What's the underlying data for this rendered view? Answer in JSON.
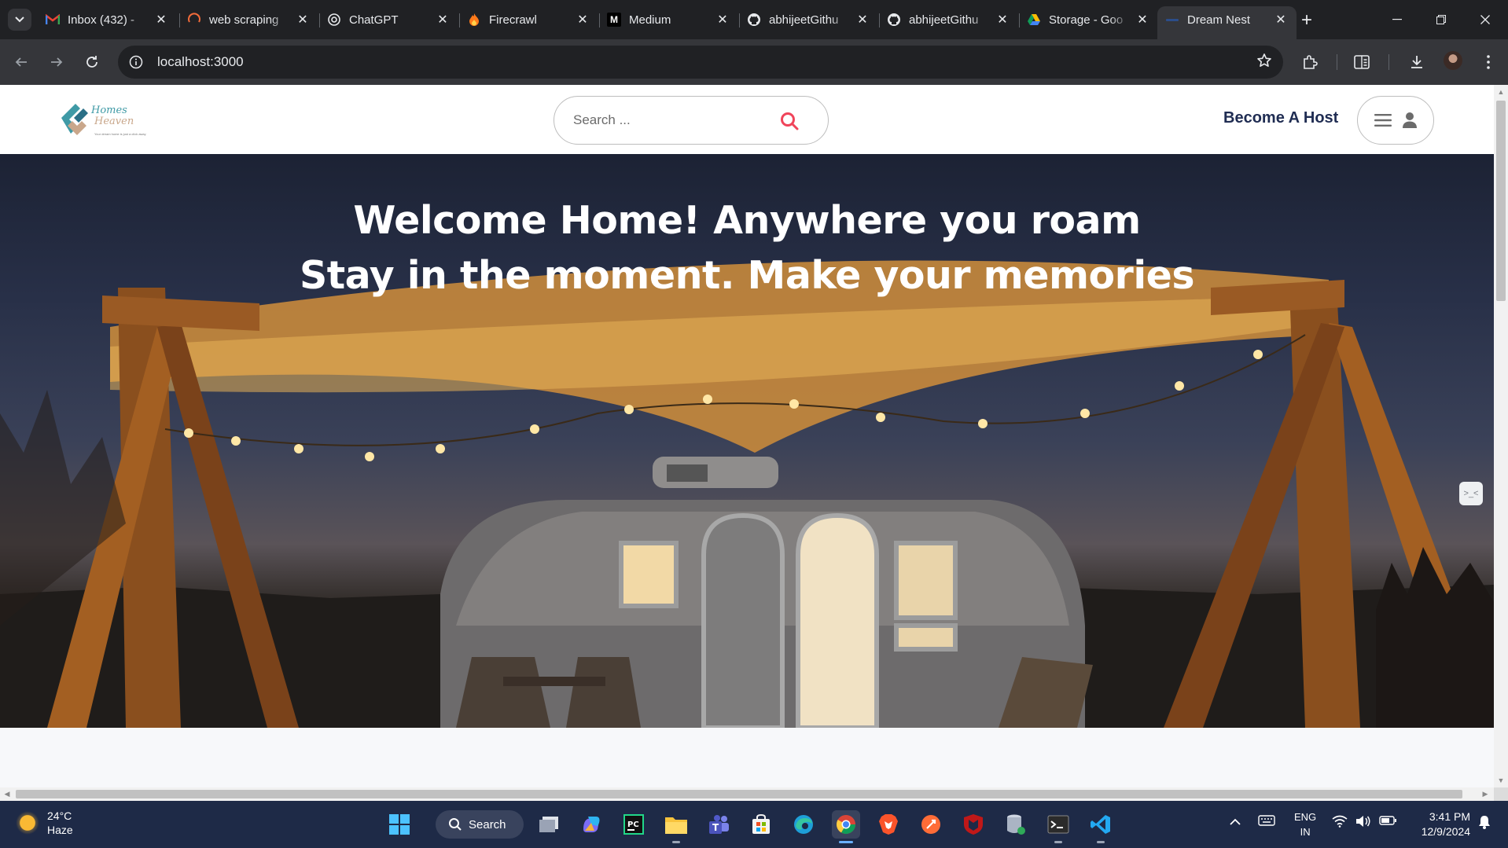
{
  "browser": {
    "tabs": [
      {
        "title": "Inbox (432) -",
        "icon": "gmail-icon"
      },
      {
        "title": "web scraping",
        "icon": "loading-spinner-icon"
      },
      {
        "title": "ChatGPT",
        "icon": "chatgpt-icon"
      },
      {
        "title": "Firecrawl",
        "icon": "fire-icon"
      },
      {
        "title": "Medium",
        "icon": "medium-icon"
      },
      {
        "title": "abhijeetGithu",
        "icon": "github-icon"
      },
      {
        "title": "abhijeetGithu",
        "icon": "github-icon"
      },
      {
        "title": "Storage - Goo",
        "icon": "google-drive-icon"
      },
      {
        "title": "Dream Nest",
        "icon": "site-icon",
        "active": true
      }
    ],
    "url": "localhost:3000"
  },
  "site": {
    "logo_line1": "Homes",
    "logo_line2": "Heaven",
    "logo_tagline": "Your dream home is just a click away",
    "search_placeholder": "Search ...",
    "become_host": "Become A Host",
    "hero_line1": "Welcome Home! Anywhere you roam",
    "hero_line2": "Stay in the moment. Make your memories",
    "side_chip": ">_<"
  },
  "taskbar": {
    "weather_temp": "24°C",
    "weather_condition": "Haze",
    "search_label": "Search",
    "lang_line1": "ENG",
    "lang_line2": "IN",
    "time": "3:41 PM",
    "date": "12/9/2024"
  },
  "colors": {
    "brand_teal": "#3f9aa6",
    "brand_tan": "#c9a78b",
    "search_accent": "#f0445a",
    "host_text": "#1f2c52"
  }
}
